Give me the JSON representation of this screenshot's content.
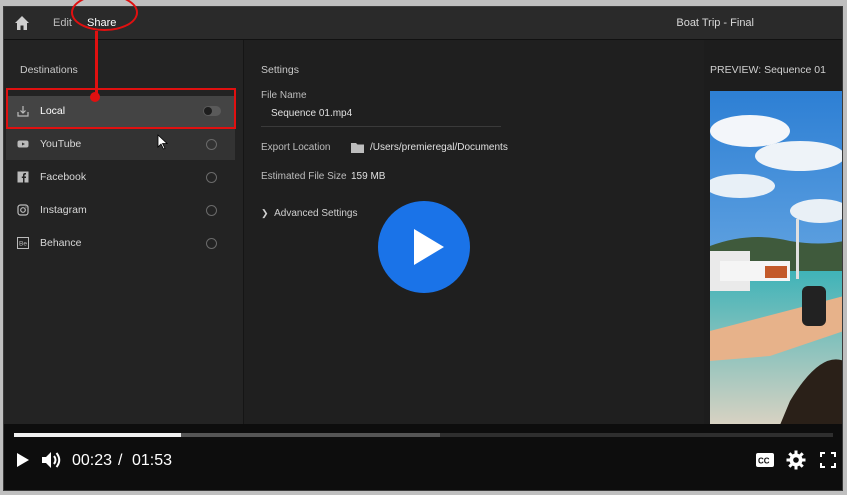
{
  "topbar": {
    "nav": [
      "Edit",
      "Share"
    ],
    "title": "Boat Trip - Final"
  },
  "destinations": {
    "heading": "Destinations",
    "items": [
      {
        "label": "Local",
        "icon": "download-icon",
        "state": "selected"
      },
      {
        "label": "YouTube",
        "icon": "youtube-icon",
        "state": "hover"
      },
      {
        "label": "Facebook",
        "icon": "facebook-icon",
        "state": "off"
      },
      {
        "label": "Instagram",
        "icon": "instagram-icon",
        "state": "off"
      },
      {
        "label": "Behance",
        "icon": "behance-icon",
        "state": "off"
      }
    ]
  },
  "settings": {
    "heading": "Settings",
    "file_name_label": "File Name",
    "file_name_value": "Sequence 01.mp4",
    "export_location_label": "Export Location",
    "export_location_value": "/Users/premieregal/Documents",
    "file_size_label": "Estimated File Size",
    "file_size_value": "159 MB",
    "advanced": "Advanced Settings"
  },
  "preview": {
    "title": "PREVIEW: Sequence 01"
  },
  "player": {
    "current_time": "00:23",
    "separator": "/",
    "duration": "01:53",
    "played_fraction": 0.204,
    "buffered_fraction": 0.52
  },
  "colors": {
    "annotation": "#e01010",
    "play_button": "#1a73e8"
  }
}
